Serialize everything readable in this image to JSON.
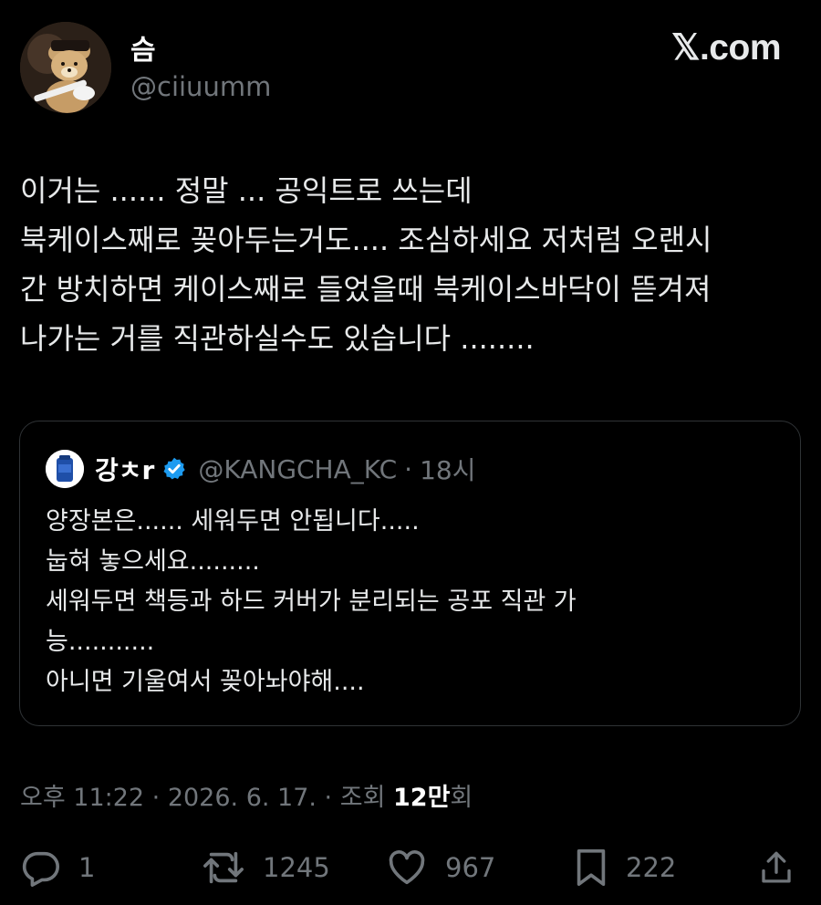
{
  "author": {
    "name": "슴",
    "handle": "@ciiuumm"
  },
  "brand": {
    "logo_text": "𝕏.com"
  },
  "tweet": {
    "lines": [
      "이거는 ...... 정말 ... 공익트로 쓰는데",
      "북케이스째로 꽂아두는거도.... 조심하세요 저처럼 오랜시",
      "간 방치하면 케이스째로 들었을때 북케이스바닥이 뜯겨져",
      "나가는 거를 직관하실수도 있습니다 ........"
    ]
  },
  "quote": {
    "name": "강ㅊr",
    "handle": "@KANGCHA_KC",
    "separator": "·",
    "time": "18시",
    "lines": [
      "양장본은...... 세워두면 안됩니다.....",
      "눕혀 놓으세요.........",
      "세워두면 책등과 하드 커버가 분리되는 공포 직관 가",
      "능...........",
      "아니면 기울여서 꽂아놔야해...."
    ]
  },
  "meta": {
    "datetime": "오후 11:22 · 2026. 6. 17. · 조회 ",
    "views": "12만",
    "views_suffix": "회"
  },
  "actions": {
    "replies": "1",
    "retweets": "1245",
    "likes": "967",
    "bookmarks": "222"
  },
  "colors": {
    "background": "#000000",
    "text": "#e7e9ea",
    "secondary": "#71767b",
    "border": "#2f3336",
    "verified": "#1d9bf0"
  },
  "icons": [
    "reply-icon",
    "retweet-icon",
    "like-icon",
    "bookmark-icon",
    "share-icon",
    "verified-badge-icon"
  ]
}
